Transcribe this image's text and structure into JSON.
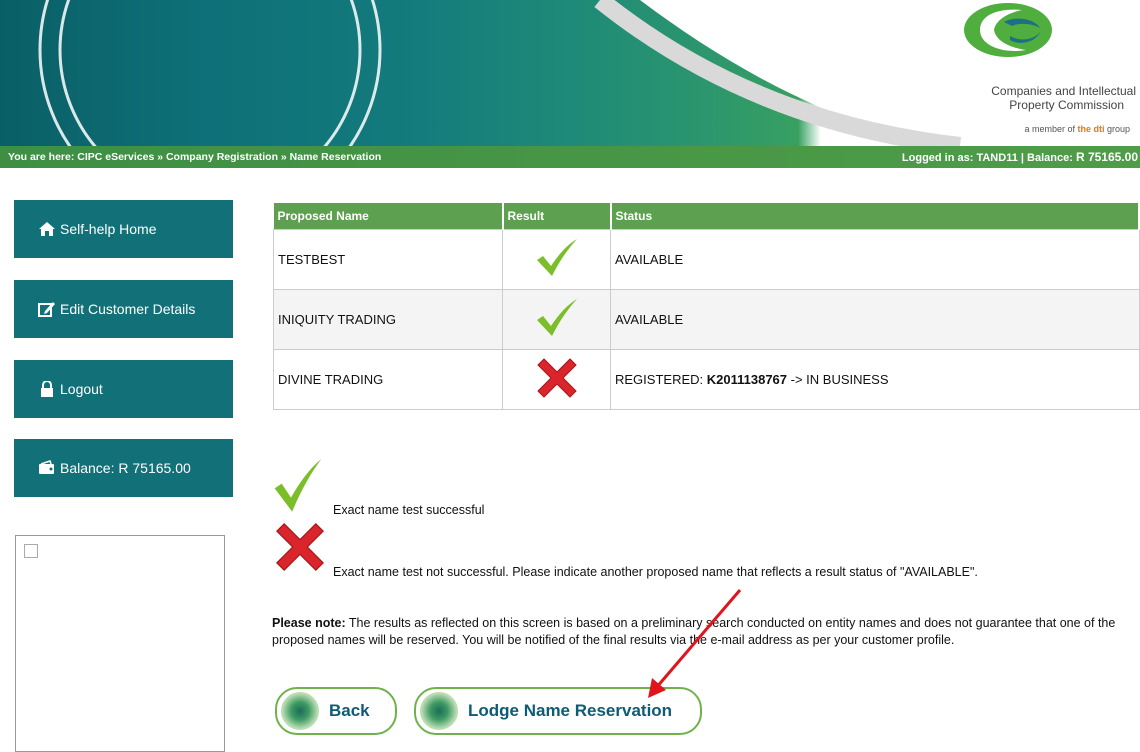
{
  "header": {
    "logo_line1": "Companies and Intellectual",
    "logo_line2": "Property Commission",
    "logo_line3_pre": "a member of ",
    "logo_line3_dti": "the dti",
    "logo_line3_post": " group"
  },
  "breadcrumb": {
    "text": "You are here: CIPC eServices » Company Registration » Name Reservation",
    "login_prefix": "Logged in as: TAND11 | Balance: ",
    "login_balance": "R 75165.00"
  },
  "sidebar": {
    "items": [
      {
        "label": "Self-help Home",
        "icon": "home-icon"
      },
      {
        "label": "Edit Customer Details",
        "icon": "edit-icon"
      },
      {
        "label": "Logout",
        "icon": "lock-icon"
      },
      {
        "label": "Balance: R 75165.00",
        "icon": "wallet-icon"
      }
    ]
  },
  "table": {
    "headers": [
      "Proposed Name",
      "Result",
      "Status"
    ],
    "rows": [
      {
        "name": "TESTBEST",
        "result": "check",
        "status": "AVAILABLE"
      },
      {
        "name": "INIQUITY TRADING",
        "result": "check",
        "status": "AVAILABLE"
      },
      {
        "name": "DIVINE TRADING",
        "result": "cross",
        "status_prefix": "REGISTERED: ",
        "status_bold": "K2011138767",
        "status_suffix": " -> IN BUSINESS"
      }
    ]
  },
  "legend": {
    "success": "Exact name test successful",
    "fail": "Exact name test not successful. Please indicate another proposed name that reflects a result status of \"AVAILABLE\"."
  },
  "note": {
    "bold": "Please note:",
    "text": " The results as reflected on this screen is based on a preliminary search conducted on entity names and does not guarantee that one of the proposed names will be reserved. You will be notified of the final results via the e-mail address as per your customer profile."
  },
  "buttons": {
    "back": "Back",
    "lodge": "Lodge Name Reservation"
  },
  "colors": {
    "teal": "#127079",
    "green": "#5da050",
    "button_text": "#0d5b74",
    "annotation_arrow": "#e0141b"
  }
}
